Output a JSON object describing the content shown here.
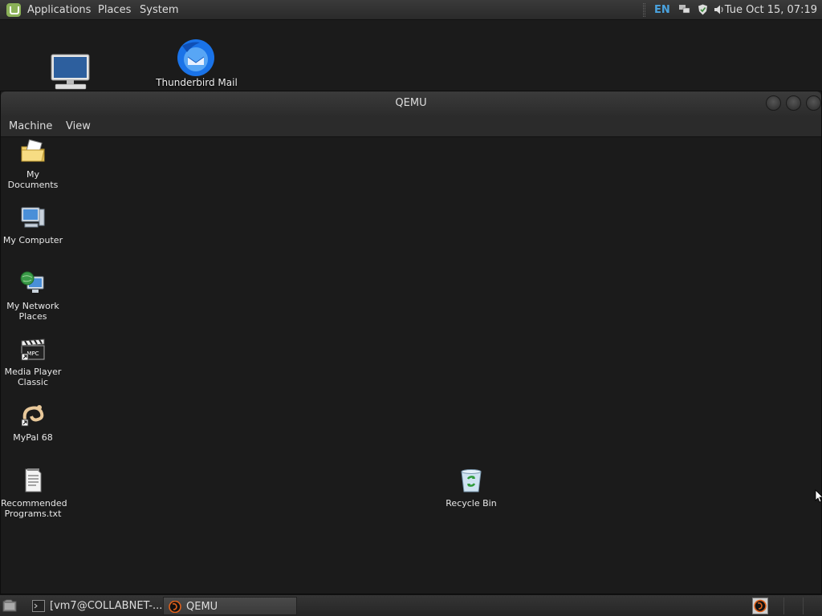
{
  "top_panel": {
    "menus": [
      "Applications",
      "Places",
      "System"
    ],
    "keyboard_layout": "EN",
    "clock": "Tue Oct 15, 07:19"
  },
  "host_desktop": {
    "icons": [
      {
        "label": "",
        "icon": "computer-icon"
      },
      {
        "label": "Thunderbird Mail",
        "icon": "thunderbird-icon"
      }
    ]
  },
  "qemu_window": {
    "title": "QEMU",
    "menu": [
      "Machine",
      "View"
    ]
  },
  "guest_desktop": {
    "icons": [
      {
        "label": "My Documents",
        "icon": "folder-documents-icon"
      },
      {
        "label": "My Computer",
        "icon": "computer-icon"
      },
      {
        "label": "My Network Places",
        "icon": "network-places-icon"
      },
      {
        "label": "Media Player Classic",
        "icon": "media-player-icon"
      },
      {
        "label": "MyPal 68",
        "icon": "mypal-icon"
      },
      {
        "label": "Recommended Programs.txt",
        "icon": "text-file-icon"
      },
      {
        "label": "Recycle Bin",
        "icon": "recycle-bin-icon"
      }
    ]
  },
  "bottom_panel": {
    "tasks": [
      {
        "label": "[vm7@COLLABNET-...",
        "icon": "terminal-icon",
        "active": false
      },
      {
        "label": "QEMU",
        "icon": "qemu-icon",
        "active": true
      }
    ]
  },
  "colors": {
    "panel_bg": "#2e2e2e",
    "desktop_bg": "#1b1b1b",
    "lang_indicator": "#4aa3df",
    "mint_green": "#8bb158"
  }
}
